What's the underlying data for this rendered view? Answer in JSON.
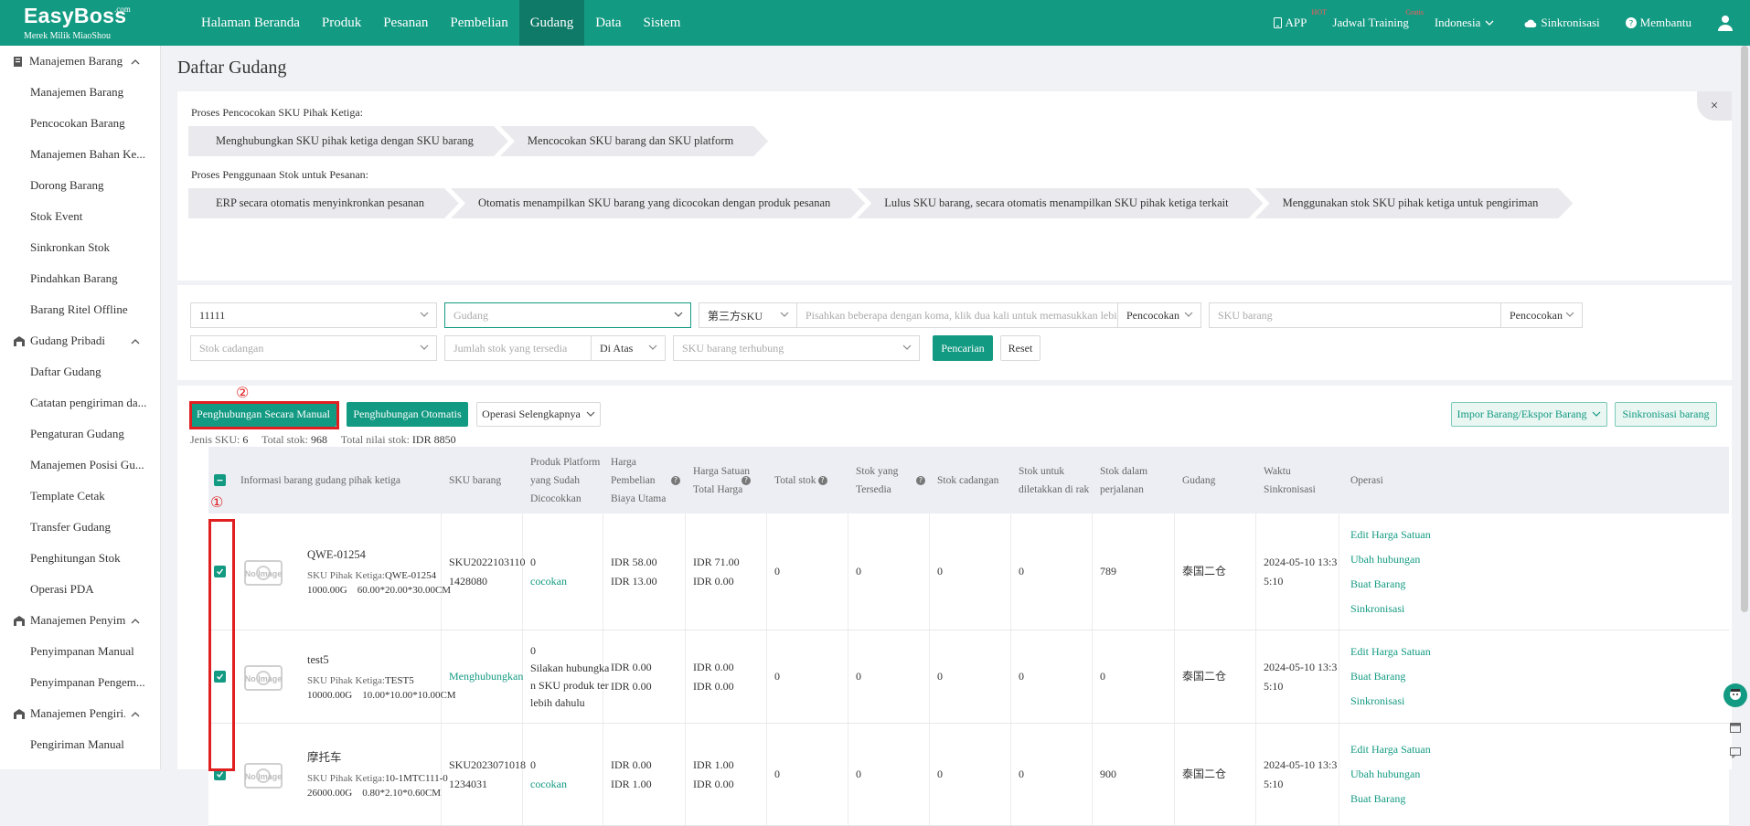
{
  "brand": {
    "name": "EasyBoss",
    "suffix": ".com",
    "tagline": "Merek Milik MiaoShou"
  },
  "nav": [
    "Halaman Beranda",
    "Produk",
    "Pesanan",
    "Pembelian",
    "Gudang",
    "Data",
    "Sistem"
  ],
  "nav_active": "Gudang",
  "topright": {
    "app": "APP",
    "app_sup": "HOT",
    "training": "Jadwal Training",
    "training_sup": "Gratis",
    "language": "Indonesia",
    "sync": "Sinkronisasi",
    "help": "Membantu"
  },
  "sidebar": [
    {
      "group": "Manajemen Barang",
      "items": [
        "Manajemen Barang",
        "Pencocokan Barang",
        "Manajemen Bahan Ke...",
        "Dorong Barang",
        "Stok Event",
        "Sinkronkan Stok",
        "Pindahkan Barang",
        "Barang Ritel Offline"
      ]
    },
    {
      "group": "Gudang Pribadi",
      "items": [
        "Daftar Gudang",
        "Catatan pengiriman da...",
        "Pengaturan Gudang",
        "Manajemen Posisi Gu...",
        "Template Cetak",
        "Transfer Gudang",
        "Penghitungan Stok",
        "Operasi PDA"
      ]
    },
    {
      "group": "Manajemen Penyim...",
      "items": [
        "Penyimpanan Manual",
        "Penyimpanan Pengem..."
      ]
    },
    {
      "group": "Manajemen Pengiri...",
      "items": [
        "Pengiriman Manual"
      ]
    }
  ],
  "page_title": "Daftar Gudang",
  "flow": {
    "label1": "Proses Pencocokan SKU Pihak Ketiga:",
    "steps1": [
      "Menghubungkan SKU pihak ketiga dengan SKU barang",
      "Mencocokan SKU barang dan SKU platform"
    ],
    "label2": "Proses Penggunaan Stok untuk Pesanan:",
    "steps2": [
      "ERP secara otomatis menyinkronkan pesanan",
      "Otomatis menampilkan SKU barang yang dicocokan dengan produk pesanan",
      "Lulus SKU barang, secara otomatis menampilkan SKU pihak ketiga terkait",
      "Menggunakan stok SKU pihak ketiga untuk pengiriman"
    ],
    "close": "×"
  },
  "filters": {
    "account": "11111",
    "warehouse_placeholder": "Gudang",
    "sku_type": "第三方SKU",
    "sku_search_placeholder": "Pisahkan beberapa dengan koma, klik dua kali untuk memasukkan lebi",
    "match1": "Pencocokan",
    "goods_sku_placeholder": "SKU barang",
    "match2": "Pencocokan",
    "reserve_placeholder": "Stok cadangan",
    "qty_placeholder": "Jumlah stok yang tersedia",
    "qty_op": "Di Atas",
    "linked_placeholder": "SKU barang terhubung",
    "search_btn": "Pencarian",
    "reset_btn": "Reset"
  },
  "toolbar": {
    "manual": "Penghubungan Secara Manual",
    "auto": "Penghubungan Otomatis",
    "more": "Operasi Selengkapnya",
    "import": "Impor Barang/Ekspor Barang",
    "sync": "Sinkronisasi barang"
  },
  "stats": {
    "sku_kinds_label": "Jenis SKU:",
    "sku_kinds": "6",
    "total_stock_label": "Total stok:",
    "total_stock": "968",
    "total_value_label": "Total nilai stok:",
    "total_value": "IDR 8850"
  },
  "headers": {
    "info": "Informasi barang gudang pihak ketiga",
    "sku": "SKU barang",
    "matched": [
      "Produk Platform",
      "yang Sudah",
      "Dicocokkan"
    ],
    "cost": [
      "Harga",
      "Pembelian",
      "Biaya Utama"
    ],
    "unit": [
      "Harga Satuan",
      "Total Harga"
    ],
    "total": "Total stok",
    "available": [
      "Stok yang",
      "Tersedia"
    ],
    "reserve": "Stok cadangan",
    "shelf": [
      "Stok untuk",
      "diletakkan di rak"
    ],
    "transit": [
      "Stok dalam",
      "perjalanan"
    ],
    "warehouse": "Gudang",
    "synctime": [
      "Waktu",
      "Sinkronisasi"
    ],
    "ops": "Operasi"
  },
  "rows": [
    {
      "name": "QWE-01254",
      "third_label": "SKU Pihak Ketiga:",
      "third_sku": "QWE-01254",
      "weight": "1000.00G",
      "dims": "60.00*20.00*30.00CM",
      "sku": [
        "SKU2022103110",
        "1428080"
      ],
      "matched": [
        "0",
        "cocokan"
      ],
      "cost": [
        "IDR 58.00",
        "IDR 13.00"
      ],
      "unit": [
        "IDR 71.00",
        "IDR 0.00"
      ],
      "total": "0",
      "available": "0",
      "reserve": "0",
      "shelf": "0",
      "transit": "789",
      "warehouse": "泰国二仓",
      "time": [
        "2024-05-10 13:3",
        "5:10"
      ],
      "ops": [
        "Edit Harga Satuan",
        "Ubah hubungan",
        "Buat Barang",
        "Sinkronisasi"
      ]
    },
    {
      "name": "test5",
      "third_label": "SKU Pihak Ketiga:",
      "third_sku": "TEST5",
      "weight": "10000.00G",
      "dims": "10.00*10.00*10.00CM",
      "sku": [
        "Menghubungkan"
      ],
      "matched": [
        "0",
        "Silakan hubungka",
        "n SKU produk ter",
        "lebih dahulu"
      ],
      "cost": [
        "IDR 0.00",
        "IDR 0.00"
      ],
      "unit": [
        "IDR 0.00",
        "IDR 0.00"
      ],
      "total": "0",
      "available": "0",
      "reserve": "0",
      "shelf": "0",
      "transit": "0",
      "warehouse": "泰国二仓",
      "time": [
        "2024-05-10 13:3",
        "5:10"
      ],
      "ops": [
        "Edit Harga Satuan",
        "Buat Barang",
        "Sinkronisasi"
      ]
    },
    {
      "name": "摩托车",
      "third_label": "SKU Pihak Ketiga:",
      "third_sku": "10-1MTC111-0",
      "weight": "26000.00G",
      "dims": "0.80*2.10*0.60CM",
      "sku": [
        "SKU2023071018",
        "1234031"
      ],
      "matched": [
        "0",
        "cocokan"
      ],
      "cost": [
        "IDR 0.00",
        "IDR 1.00"
      ],
      "unit": [
        "IDR 1.00",
        "IDR 0.00"
      ],
      "total": "0",
      "available": "0",
      "reserve": "0",
      "shelf": "0",
      "transit": "900",
      "warehouse": "泰国二仓",
      "time": [
        "2024-05-10 13:3",
        "5:10"
      ],
      "ops": [
        "Edit Harga Satuan",
        "Ubah hubungan",
        "Buat Barang"
      ]
    }
  ],
  "noimage_text": "No Image",
  "annotations": {
    "circle1": "①",
    "circle2": "②"
  },
  "colors": {
    "brand": "#139a82",
    "highlight": "#e02020"
  }
}
